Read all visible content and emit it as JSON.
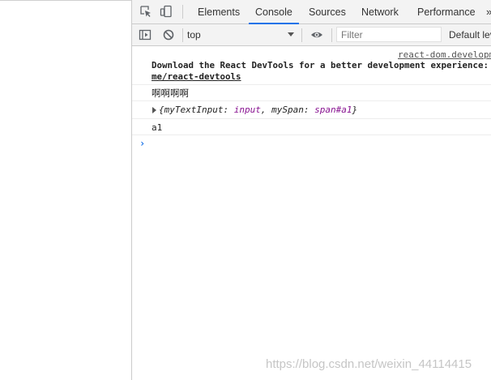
{
  "devtools": {
    "tabs": [
      {
        "label": "Elements"
      },
      {
        "label": "Console",
        "active": true
      },
      {
        "label": "Sources"
      },
      {
        "label": "Network"
      },
      {
        "label": "Performance"
      }
    ],
    "more_tabs_icon": "»",
    "accent_color": "#1a73e8"
  },
  "toolbar": {
    "context": "top",
    "filter_placeholder": "Filter",
    "levels": "Default lev"
  },
  "console": {
    "messages": [
      {
        "source": "react-dom.developm",
        "text": "Download the React DevTools for a better development experience:",
        "link": "me/react-devtools"
      },
      {
        "text": "啊啊啊啊"
      },
      {
        "object": {
          "open": "{",
          "key1": "myTextInput",
          "val1": "input",
          "sep": ", ",
          "key2": "mySpan",
          "val2": "span#a1",
          "close": "}"
        }
      },
      {
        "text": "a1"
      }
    ],
    "prompt_symbol": "›"
  },
  "watermark": "https://blog.csdn.net/weixin_44114415"
}
